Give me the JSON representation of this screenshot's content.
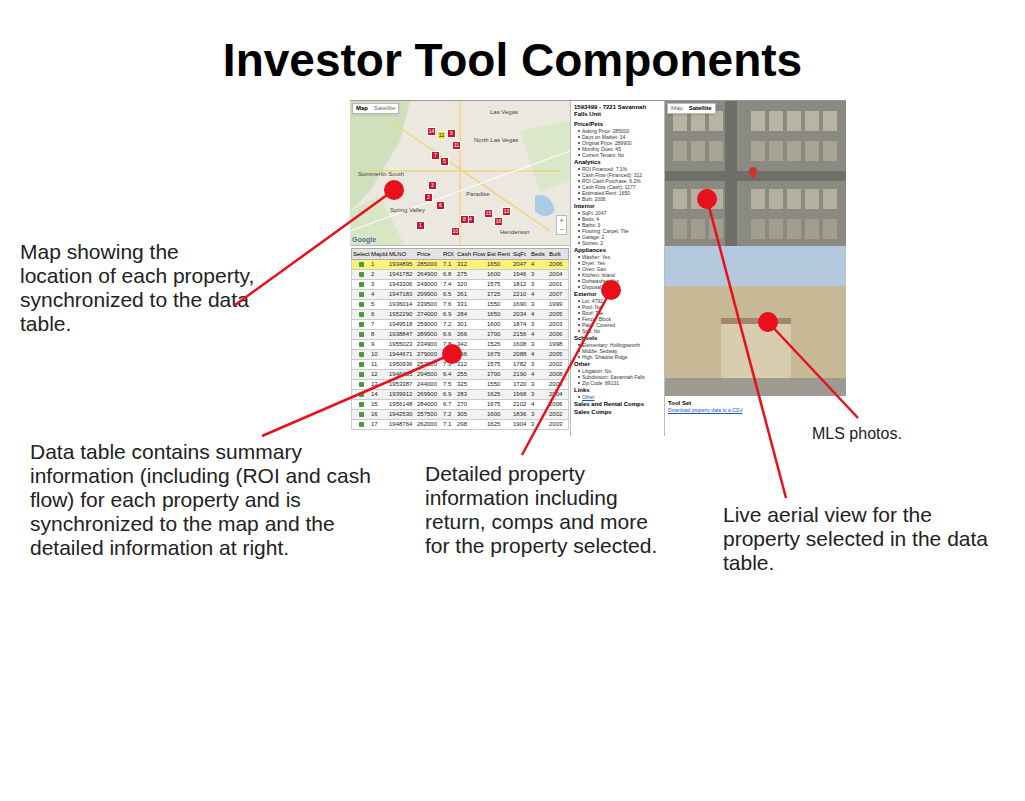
{
  "slide": {
    "title": "Investor Tool Components"
  },
  "map": {
    "view_buttons": [
      {
        "label": "Map",
        "selected": true
      },
      {
        "label": "Satellite",
        "selected": false
      }
    ],
    "place_labels": [
      "Las Vegas",
      "North Las Vegas",
      "Paradise",
      "Spring Valley",
      "Summerlin South",
      "Henderson"
    ],
    "pins": [
      {
        "label": "14",
        "selected": false
      },
      {
        "label": "12",
        "selected": true
      },
      {
        "label": "9",
        "selected": false
      },
      {
        "label": "11",
        "selected": false
      },
      {
        "label": "7",
        "selected": false
      },
      {
        "label": "5",
        "selected": false
      },
      {
        "label": "3",
        "selected": false
      },
      {
        "label": "2",
        "selected": false
      },
      {
        "label": "6",
        "selected": false
      },
      {
        "label": "4",
        "selected": false
      },
      {
        "label": "15",
        "selected": false
      },
      {
        "label": "16",
        "selected": false
      },
      {
        "label": "13",
        "selected": false
      },
      {
        "label": "10",
        "selected": false
      },
      {
        "label": "8",
        "selected": false
      },
      {
        "label": "1",
        "selected": false
      }
    ],
    "zoom_buttons": [
      "+",
      "−"
    ],
    "attribution": "Google"
  },
  "table": {
    "columns": [
      "Select",
      "MapId",
      "MLNO",
      "Price",
      "ROI",
      "Cash Flow",
      "Est Rent",
      "SqFt",
      "Beds",
      "Built"
    ],
    "rows": [
      {
        "cells": [
          "1",
          "1934895",
          "285000",
          "7.1",
          "312",
          "1650",
          "2047",
          "4",
          "2006"
        ],
        "selected": true
      },
      {
        "cells": [
          "2",
          "1941782",
          "264900",
          "6.8",
          "275",
          "1600",
          "1946",
          "3",
          "2004"
        ],
        "selected": false
      },
      {
        "cells": [
          "3",
          "1943306",
          "249000",
          "7.4",
          "320",
          "1575",
          "1812",
          "3",
          "2001"
        ],
        "selected": false
      },
      {
        "cells": [
          "4",
          "1947183",
          "299900",
          "6.5",
          "261",
          "1725",
          "2210",
          "4",
          "2007"
        ],
        "selected": false
      },
      {
        "cells": [
          "5",
          "1936014",
          "239500",
          "7.6",
          "331",
          "1550",
          "1690",
          "3",
          "1999"
        ],
        "selected": false
      },
      {
        "cells": [
          "6",
          "1952290",
          "274000",
          "6.9",
          "284",
          "1650",
          "2034",
          "4",
          "2005"
        ],
        "selected": false
      },
      {
        "cells": [
          "7",
          "1949518",
          "259000",
          "7.2",
          "301",
          "1600",
          "1874",
          "3",
          "2003"
        ],
        "selected": false
      },
      {
        "cells": [
          "8",
          "1938847",
          "289900",
          "6.6",
          "266",
          "1700",
          "2156",
          "4",
          "2006"
        ],
        "selected": false
      },
      {
        "cells": [
          "9",
          "1955023",
          "234900",
          "7.8",
          "342",
          "1525",
          "1608",
          "3",
          "1998"
        ],
        "selected": false
      },
      {
        "cells": [
          "10",
          "1944671",
          "279000",
          "7.0",
          "296",
          "1675",
          "2088",
          "4",
          "2005"
        ],
        "selected": false
      },
      {
        "cells": [
          "11",
          "1950936",
          "252500",
          "7.3",
          "312",
          "1575",
          "1782",
          "3",
          "2002"
        ],
        "selected": false
      },
      {
        "cells": [
          "12",
          "1946205",
          "294500",
          "6.4",
          "255",
          "1700",
          "2190",
          "4",
          "2008"
        ],
        "selected": false
      },
      {
        "cells": [
          "13",
          "1953387",
          "244000",
          "7.5",
          "325",
          "1550",
          "1720",
          "3",
          "2000"
        ],
        "selected": false
      },
      {
        "cells": [
          "14",
          "1939912",
          "269900",
          "6.9",
          "283",
          "1625",
          "1968",
          "3",
          "2004"
        ],
        "selected": false
      },
      {
        "cells": [
          "15",
          "1956148",
          "284000",
          "6.7",
          "270",
          "1675",
          "2102",
          "4",
          "2006"
        ],
        "selected": false
      },
      {
        "cells": [
          "16",
          "1942530",
          "257500",
          "7.2",
          "305",
          "1600",
          "1836",
          "3",
          "2002"
        ],
        "selected": false
      },
      {
        "cells": [
          "17",
          "1948764",
          "262000",
          "7.1",
          "298",
          "1625",
          "1904",
          "3",
          "2003"
        ],
        "selected": false
      }
    ]
  },
  "details": {
    "heading": "1593499 - 7221 Savannah Falls Unit",
    "sections": [
      {
        "title": "Price/Pets",
        "kind": "list",
        "items": [
          "Asking Price: 285000",
          "Days on Market: 14",
          "Original Price: 289900",
          "Monthly Dues: 45",
          "Current Tenant: No"
        ]
      },
      {
        "title": "Analytics",
        "kind": "list",
        "items": [
          "ROI Financed: 7.1%",
          "Cash Flow (Financed): 312",
          "ROI Cash Purchase: 6.2%",
          "Cash Flow (Cash): 1177",
          "Estimated Rent: 1650",
          "Built: 2006"
        ]
      },
      {
        "title": "Interior",
        "kind": "list",
        "items": [
          "SqFt: 2047",
          "Beds: 4",
          "Baths: 3",
          "Flooring: Carpet, Tile",
          "Garage: 2",
          "Stories: 2"
        ]
      },
      {
        "title": "Appliances",
        "kind": "list",
        "items": [
          "Washer: Yes",
          "Dryer: Yes",
          "Oven: Gas",
          "Kitchen: Island",
          "Dishwasher: Yes",
          "Disposal: Yes"
        ]
      },
      {
        "title": "Exterior",
        "kind": "list",
        "items": [
          "Lot: 4792",
          "Pool: No",
          "Roof: Tile",
          "Fence: Block",
          "Patio: Covered",
          "Spa: No"
        ]
      },
      {
        "title": "Schools",
        "kind": "list",
        "items": [
          "Elementary: Hollingsworth",
          "Middle: Sedway",
          "High: Shadow Ridge"
        ]
      },
      {
        "title": "Other",
        "kind": "list",
        "items": [
          "Litigation: No",
          "Subdivision: Savannah Falls",
          "Zip Code: 89131"
        ]
      },
      {
        "title": "Links",
        "kind": "links",
        "items": [
          "Other"
        ]
      },
      {
        "title": "Sales and Rental Comps",
        "kind": "list",
        "items": []
      },
      {
        "title": "Sales Comps",
        "kind": "list",
        "items": []
      }
    ]
  },
  "aerial": {
    "view_buttons": [
      {
        "label": "Map",
        "selected": false
      },
      {
        "label": "Satellite",
        "selected": true
      }
    ]
  },
  "tool_set": {
    "title": "Tool Set",
    "link": "Download property data to a CSV"
  },
  "callouts": [
    {
      "text": "Map showing the location of each property, synchronized to the data table."
    },
    {
      "text": "Data table contains summary information (including (ROI and cash flow) for each property and is synchronized to the map and the detailed information at right."
    },
    {
      "text": "Detailed property information including return, comps and more for the property selected."
    },
    {
      "text": "Live aerial view for the property selected in the data table."
    },
    {
      "text": "MLS photos."
    }
  ]
}
